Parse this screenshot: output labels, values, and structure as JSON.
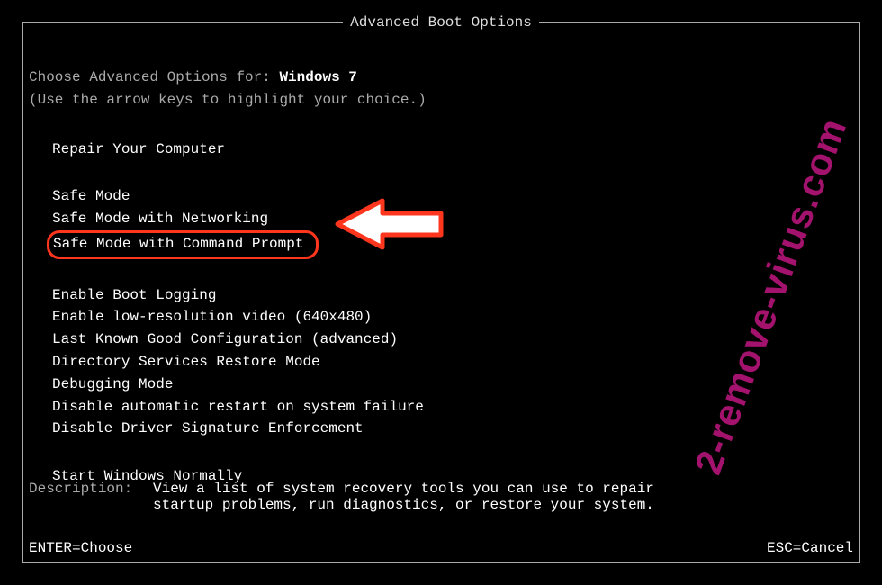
{
  "title": "Advanced Boot Options",
  "choose_label": "Choose Advanced Options for: ",
  "os_name": "Windows 7",
  "hint": "(Use the arrow keys to highlight your choice.)",
  "groups": [
    {
      "items": [
        {
          "label": "Repair Your Computer",
          "highlighted": false
        }
      ]
    },
    {
      "items": [
        {
          "label": "Safe Mode",
          "highlighted": false
        },
        {
          "label": "Safe Mode with Networking",
          "highlighted": false
        },
        {
          "label": "Safe Mode with Command Prompt",
          "highlighted": true
        }
      ]
    },
    {
      "items": [
        {
          "label": "Enable Boot Logging",
          "highlighted": false
        },
        {
          "label": "Enable low-resolution video (640x480)",
          "highlighted": false
        },
        {
          "label": "Last Known Good Configuration (advanced)",
          "highlighted": false
        },
        {
          "label": "Directory Services Restore Mode",
          "highlighted": false
        },
        {
          "label": "Debugging Mode",
          "highlighted": false
        },
        {
          "label": "Disable automatic restart on system failure",
          "highlighted": false
        },
        {
          "label": "Disable Driver Signature Enforcement",
          "highlighted": false
        }
      ]
    },
    {
      "items": [
        {
          "label": "Start Windows Normally",
          "highlighted": false
        }
      ]
    }
  ],
  "description_label": "Description:",
  "description_text": "View a list of system recovery tools you can use to repair startup problems, run diagnostics, or restore your system.",
  "footer_left": "ENTER=Choose",
  "footer_right": "ESC=Cancel",
  "watermark": "2-remove-virus.com",
  "colors": {
    "highlight_border": "#fe361e",
    "watermark": "#a3126d"
  }
}
